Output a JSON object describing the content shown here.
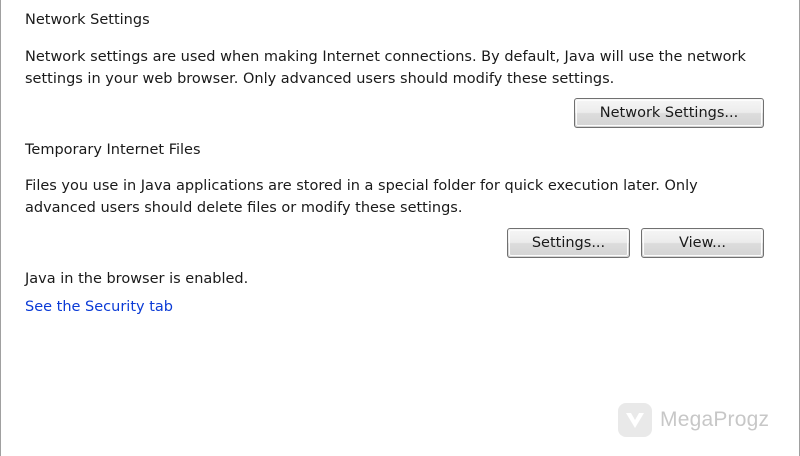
{
  "network": {
    "heading": "Network Settings",
    "description_line1": "Network settings are used when making Internet connections. By default, Java will use the network",
    "description_line2": "settings in your web browser. Only advanced users should modify these settings.",
    "button_label": "Network Settings..."
  },
  "temp_files": {
    "heading": "Temporary Internet Files",
    "description_line1": "Files you use in Java applications are stored in a special folder for quick execution later. Only",
    "description_line2": "advanced users should delete files or modify these settings.",
    "settings_button_label": "Settings...",
    "view_button_label": "View..."
  },
  "browser": {
    "status_text": "Java in the browser is enabled.",
    "security_link_text": "See the Security tab"
  },
  "watermark": {
    "text": "MegaProgz",
    "icon": "megaprogz-logo-icon"
  },
  "colors": {
    "link": "#0b3bd6",
    "text": "#1a1a1a"
  }
}
